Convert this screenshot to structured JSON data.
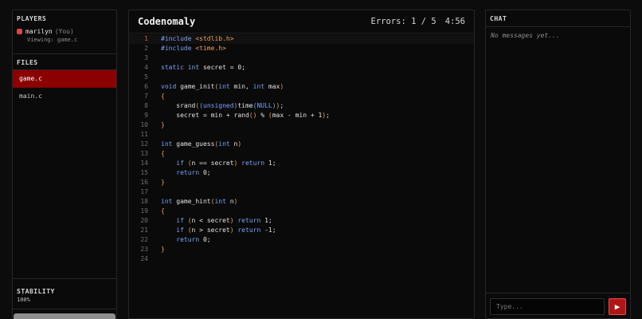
{
  "left": {
    "players_title": "PLAYERS",
    "player": {
      "name": "marilyn",
      "you": "(You)",
      "viewing": "Viewing: game.c",
      "color": "#d94848"
    },
    "files_title": "FILES",
    "files": [
      {
        "name": "game.c",
        "active": true
      },
      {
        "name": "main.c",
        "active": false
      }
    ],
    "stability_title": "STABILITY",
    "stability_value": "100%",
    "stability_fraction": 1.0
  },
  "editor": {
    "title": "Codenomaly",
    "errors": "Errors: 1 / 5",
    "timer": "4:56",
    "current_line": 1,
    "lines": [
      [
        [
          "kw",
          "#include "
        ],
        [
          "str",
          "<stdlib.h>"
        ]
      ],
      [
        [
          "kw",
          "#include "
        ],
        [
          "str",
          "<time.h>"
        ]
      ],
      [],
      [
        [
          "kw",
          "static "
        ],
        [
          "kw",
          "int "
        ],
        [
          "fn",
          "secret = 0;"
        ]
      ],
      [],
      [
        [
          "kw",
          "void "
        ],
        [
          "fn",
          "game_init"
        ],
        [
          "br",
          "("
        ],
        [
          "kw",
          "int "
        ],
        [
          "fn",
          "min, "
        ],
        [
          "kw",
          "int "
        ],
        [
          "fn",
          "max"
        ],
        [
          "br",
          ")"
        ]
      ],
      [
        [
          "br",
          "{"
        ]
      ],
      [
        [
          "fn",
          "    srand"
        ],
        [
          "br",
          "("
        ],
        [
          "kw",
          "(unsigned)"
        ],
        [
          "fn",
          "time"
        ],
        [
          "kw",
          "(NULL)"
        ],
        [
          "br",
          ")"
        ],
        [
          "fn",
          ";"
        ]
      ],
      [
        [
          "fn",
          "    secret = min + rand"
        ],
        [
          "br",
          "()"
        ],
        [
          "fn",
          " % "
        ],
        [
          "br",
          "("
        ],
        [
          "fn",
          "max - min + 1"
        ],
        [
          "br",
          ")"
        ],
        [
          "fn",
          ";"
        ]
      ],
      [
        [
          "br",
          "}"
        ]
      ],
      [],
      [
        [
          "kw",
          "int "
        ],
        [
          "fn",
          "game_guess"
        ],
        [
          "br",
          "("
        ],
        [
          "kw",
          "int "
        ],
        [
          "fn",
          "n"
        ],
        [
          "br",
          ")"
        ]
      ],
      [
        [
          "br",
          "{"
        ]
      ],
      [
        [
          "fn",
          "    "
        ],
        [
          "kw",
          "if "
        ],
        [
          "br",
          "("
        ],
        [
          "fn",
          "n == secret"
        ],
        [
          "br",
          ")"
        ],
        [
          "kw",
          " return "
        ],
        [
          "fn",
          "1;"
        ]
      ],
      [
        [
          "fn",
          "    "
        ],
        [
          "kw",
          "return "
        ],
        [
          "fn",
          "0;"
        ]
      ],
      [
        [
          "br",
          "}"
        ]
      ],
      [],
      [
        [
          "kw",
          "int "
        ],
        [
          "fn",
          "game_hint"
        ],
        [
          "br",
          "("
        ],
        [
          "kw",
          "int "
        ],
        [
          "fn",
          "n"
        ],
        [
          "br",
          ")"
        ]
      ],
      [
        [
          "br",
          "{"
        ]
      ],
      [
        [
          "fn",
          "    "
        ],
        [
          "kw",
          "if "
        ],
        [
          "br",
          "("
        ],
        [
          "fn",
          "n < secret"
        ],
        [
          "br",
          ")"
        ],
        [
          "kw",
          " return "
        ],
        [
          "fn",
          "1;"
        ]
      ],
      [
        [
          "fn",
          "    "
        ],
        [
          "kw",
          "if "
        ],
        [
          "br",
          "("
        ],
        [
          "fn",
          "n > secret"
        ],
        [
          "br",
          ")"
        ],
        [
          "kw",
          " return "
        ],
        [
          "fn",
          "-1;"
        ]
      ],
      [
        [
          "fn",
          "    "
        ],
        [
          "kw",
          "return "
        ],
        [
          "fn",
          "0;"
        ]
      ],
      [
        [
          "br",
          "}"
        ]
      ],
      []
    ]
  },
  "chat": {
    "title": "CHAT",
    "empty": "No messages yet...",
    "placeholder": "Type...",
    "send_icon": "send-icon"
  }
}
